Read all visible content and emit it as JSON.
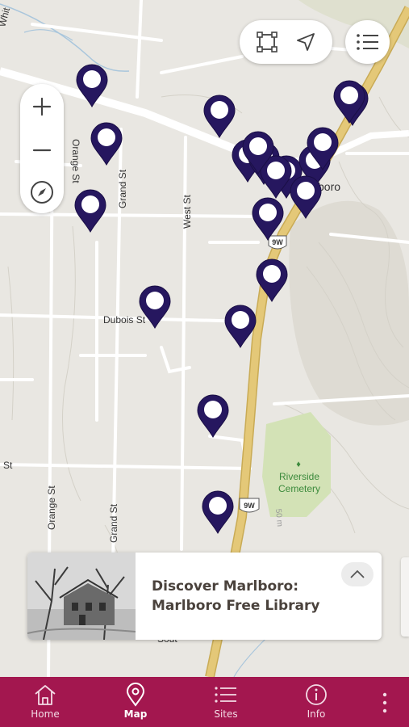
{
  "map": {
    "place_labels": {
      "whit": "Whit",
      "orange_st_north": "Orange St",
      "grand_st_north": "Grand St",
      "west_st": "West St",
      "dubois_st": "Dubois St",
      "st_left": "St",
      "orange_st_south": "Orange St",
      "grand_st_south": "Grand St",
      "marlboro_fragment": "boro",
      "riverside_cemetery_line1": "Riverside",
      "riverside_cemetery_line2": "Cemetery",
      "contour_50m": "50 m",
      "road_fragment": "Sout"
    },
    "route_shields": {
      "north": "9W",
      "south": "9W"
    },
    "marker_count": 20
  },
  "controls": {
    "zoom_in": "zoom-in",
    "zoom_out": "zoom-out",
    "compass": "compass-icon",
    "select_area": "select-area-icon",
    "locate": "locate-arrow-icon",
    "list": "list-icon"
  },
  "card": {
    "title_line1": "Discover Marlboro:",
    "title_line2": "Marlboro Free Library",
    "expand_icon": "chevron-up-icon"
  },
  "tabbar": {
    "color": "#a3174f",
    "tabs": [
      {
        "label": "Home",
        "icon": "home-icon"
      },
      {
        "label": "Map",
        "icon": "map-pin-icon",
        "active": true
      },
      {
        "label": "Sites",
        "icon": "list-icon"
      },
      {
        "label": "Info",
        "icon": "info-icon"
      }
    ],
    "more_icon": "more-vertical-icon"
  },
  "colors": {
    "marker": "#26175f",
    "highway": "#e4c878",
    "park": "#d3e2b6"
  }
}
